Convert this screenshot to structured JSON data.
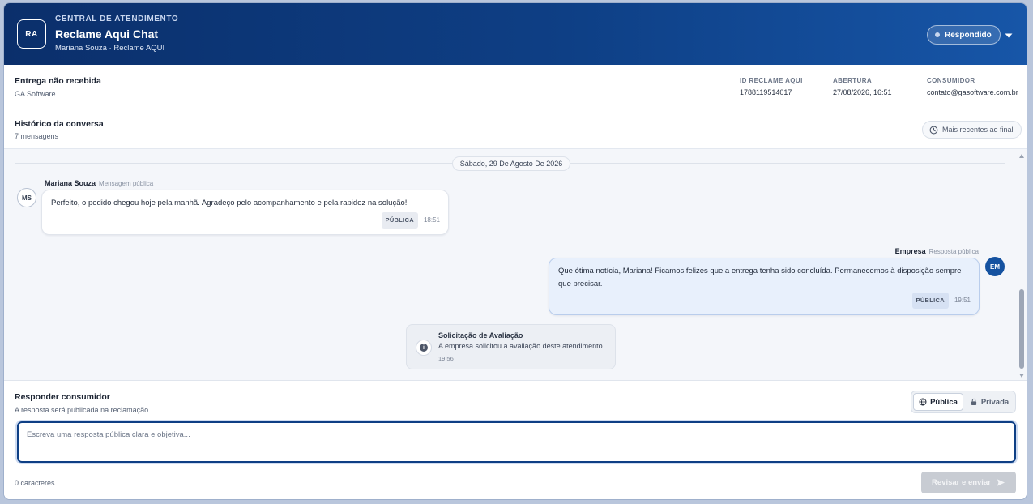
{
  "header": {
    "logo_text": "RA",
    "kicker": "CENTRAL DE ATENDIMENTO",
    "title": "Reclame Aqui Chat",
    "subtitle": "Mariana Souza · Reclame AQUI",
    "status_label": "Respondido"
  },
  "complaint": {
    "title": "Entrega não recebida",
    "company": "GA Software",
    "meta": [
      {
        "label": "ID RECLAME AQUI",
        "value": "1788119514017"
      },
      {
        "label": "ABERTURA",
        "value": "27/08/2026, 16:51"
      },
      {
        "label": "CONSUMIDOR",
        "value": "contato@gasoftware.com.br"
      }
    ]
  },
  "history": {
    "title": "Histórico da conversa",
    "count": "7 mensagens",
    "order_label": "Mais recentes ao final"
  },
  "conversation": {
    "date_separator": "Sábado, 29 De Agosto De 2026",
    "messages": [
      {
        "avatar": "MS",
        "sender": "Mariana Souza",
        "role": "Mensagem pública",
        "text": "Perfeito, o pedido chegou hoje pela manhã. Agradeço pelo acompanhamento e pela rapidez na solução!",
        "badge": "PÚBLICA",
        "time": "18:51"
      },
      {
        "avatar": "EM",
        "sender": "Empresa",
        "role": "Resposta pública",
        "text": "Que ótima notícia, Mariana! Ficamos felizes que a entrega tenha sido concluída. Permanecemos à disposição sempre que precisar.",
        "badge": "PÚBLICA",
        "time": "19:51"
      }
    ],
    "system_event": {
      "icon": "i",
      "title": "Solicitação de Avaliação",
      "text": "A empresa solicitou a avaliação deste atendimento.",
      "time": "19:56"
    }
  },
  "reply": {
    "title": "Responder consumidor",
    "subtitle": "A resposta será publicada na reclamação.",
    "visibility_public": "Pública",
    "visibility_private": "Privada",
    "placeholder": "Escreva uma resposta pública clara e objetiva...",
    "char_count": "0 caracteres",
    "send_label": "Revisar e enviar"
  },
  "colors": {
    "header_dark": "#0b2f6b",
    "header_light": "#1756a8",
    "accent": "#0e3f85",
    "outgoing_bubble": "#e8f0fc"
  }
}
